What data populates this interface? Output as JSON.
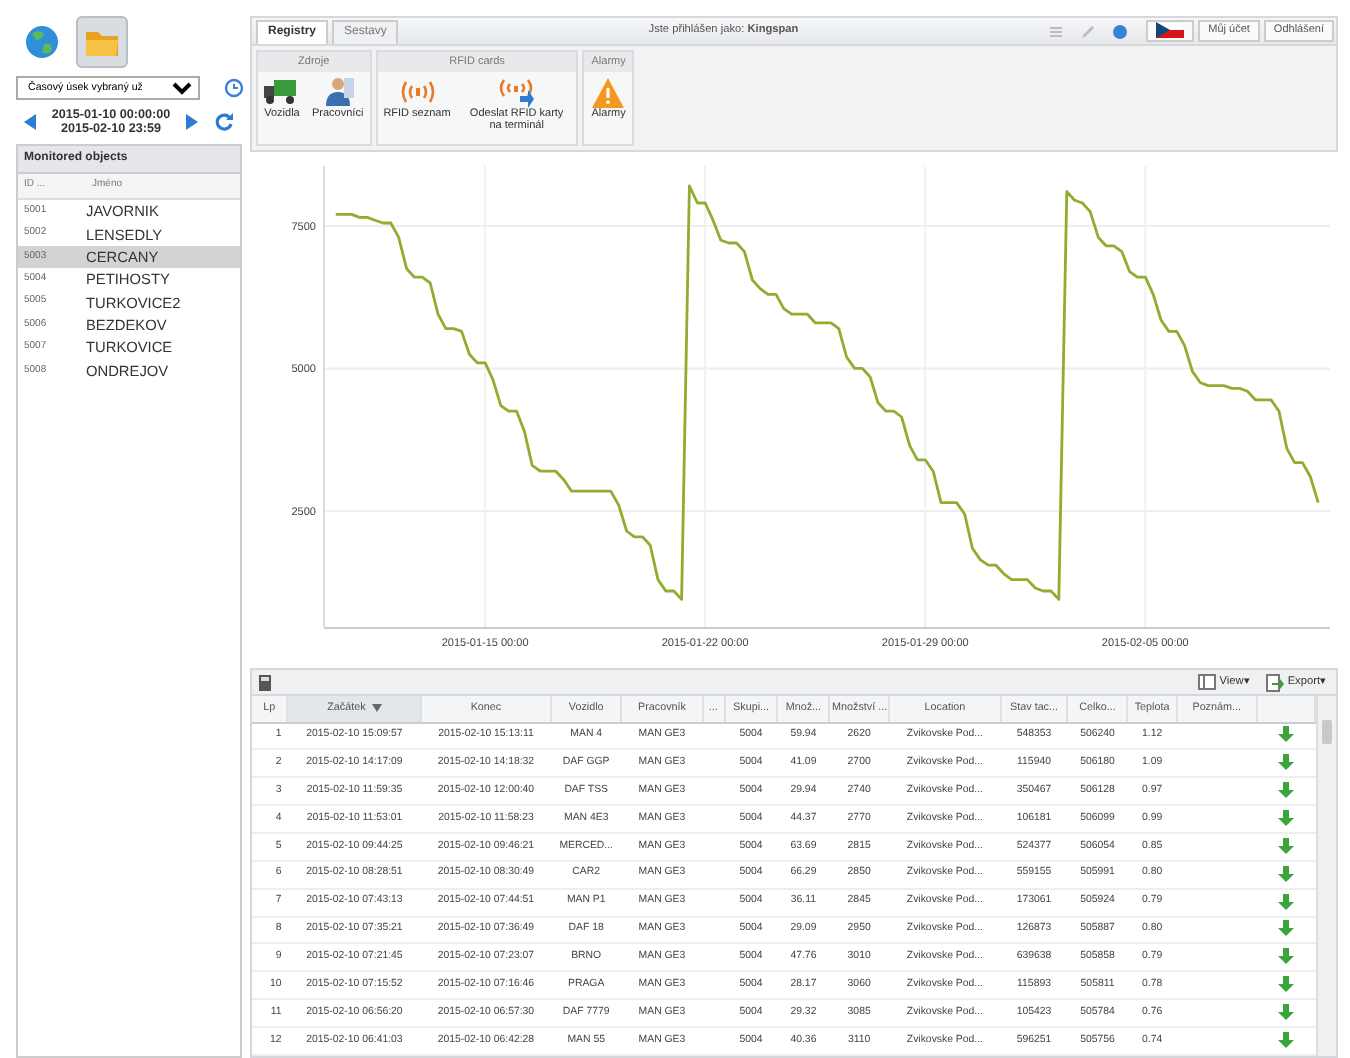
{
  "sidebar": {
    "tool_buttons": [
      {
        "selected": false
      },
      {
        "selected": true
      }
    ],
    "period_select": {
      "value": "Časový úsek vybraný už"
    },
    "date_range": {
      "from": "2015-01-10 00:00:00",
      "to": "2015-02-10 23:59"
    },
    "monitored_objects": {
      "title": "Monitored objects",
      "columns": [
        "ID ...",
        "Jméno"
      ],
      "rows": [
        {
          "id": "5001",
          "name": "JAVORNIK",
          "selected": false
        },
        {
          "id": "5002",
          "name": "LENSEDLY",
          "selected": false
        },
        {
          "id": "5003",
          "name": "CERCANY",
          "selected": true
        },
        {
          "id": "5004",
          "name": "PETIHOSTY",
          "selected": false
        },
        {
          "id": "5005",
          "name": "TURKOVICE2",
          "selected": false
        },
        {
          "id": "5006",
          "name": "BEZDEKOV",
          "selected": false
        },
        {
          "id": "5007",
          "name": "TURKOVICE",
          "selected": false
        },
        {
          "id": "5008",
          "name": "ONDREJOV",
          "selected": false
        }
      ]
    }
  },
  "tabs": [
    {
      "label": "Registry",
      "selected": true
    },
    {
      "label": "Sestavy",
      "selected": false
    }
  ],
  "login_text": "Jste přihlášen jako: **Kingspan**",
  "header_buttons": [
    "Můj účet",
    "Odhlášení"
  ],
  "ribbon": [
    {
      "title": "Zdroje",
      "buttons": [
        "Vozidla",
        "Pracovníci"
      ]
    },
    {
      "title": "RFID cards",
      "buttons": [
        "RFID seznam",
        "Odeslat RFID karty na terminál"
      ]
    },
    {
      "title": "Alarmy",
      "buttons": [
        "Alarmy"
      ]
    }
  ],
  "chart_data": {
    "type": "line",
    "grid": true,
    "ylim": [
      450,
      8550
    ],
    "yticks": [
      2500,
      5000,
      7500
    ],
    "categories": [
      null,
      null,
      null,
      null,
      null,
      null,
      null,
      null,
      null,
      null,
      null,
      null,
      null,
      null,
      null,
      null,
      null,
      null,
      null,
      null,
      "2015-01-15 00:00",
      null,
      null,
      null,
      null,
      null,
      null,
      null,
      null,
      null,
      null,
      null,
      null,
      null,
      null,
      null,
      null,
      null,
      null,
      null,
      null,
      null,
      null,
      null,
      null,
      null,
      null,
      null,
      "2015-01-22 00:00",
      null,
      null,
      null,
      null,
      null,
      null,
      null,
      null,
      null,
      null,
      null,
      null,
      null,
      null,
      null,
      null,
      null,
      null,
      null,
      null,
      null,
      null,
      null,
      null,
      null,
      null,
      null,
      "2015-01-29 00:00",
      null,
      null,
      null,
      null,
      null,
      null,
      null,
      null,
      null,
      null,
      null,
      null,
      null,
      null,
      null,
      null,
      null,
      null,
      null,
      null,
      null,
      null,
      null,
      null,
      null,
      null,
      null,
      "2015-02-05 00:00",
      null,
      null,
      null,
      null,
      null,
      null,
      null,
      null,
      null,
      null,
      null,
      null,
      null,
      null,
      null,
      null,
      null,
      null,
      null,
      null,
      null,
      null,
      null
    ],
    "series": [
      {
        "color": "#8fad2f",
        "values": [
          null,
          7700,
          7700,
          7700,
          7650,
          7650,
          7600,
          7550,
          7550,
          7300,
          6750,
          6600,
          6600,
          6500,
          5950,
          5700,
          5700,
          5650,
          5250,
          5100,
          5100,
          4800,
          4350,
          4250,
          4250,
          3900,
          3300,
          3200,
          3200,
          3200,
          3050,
          2850,
          2850,
          2850,
          2850,
          2850,
          2850,
          2600,
          2150,
          2050,
          2050,
          1900,
          1300,
          1100,
          1100,
          950,
          8200,
          7900,
          7900,
          7600,
          7250,
          7200,
          7200,
          7050,
          6550,
          6400,
          6300,
          6300,
          6050,
          5950,
          5950,
          5950,
          5800,
          5800,
          5800,
          5700,
          5200,
          5000,
          5000,
          4850,
          4400,
          4250,
          4250,
          4150,
          3650,
          3400,
          3400,
          3200,
          2650,
          2650,
          2650,
          2450,
          1850,
          1650,
          1550,
          1550,
          1400,
          1300,
          1300,
          1300,
          1150,
          1100,
          1100,
          950,
          8100,
          7950,
          7900,
          7750,
          7300,
          7150,
          7150,
          7050,
          6700,
          6600,
          6600,
          6300,
          5850,
          5650,
          5650,
          5400,
          4950,
          4750,
          4700,
          4700,
          4700,
          4650,
          4650,
          4600,
          4450,
          4450,
          4450,
          4250,
          3600,
          3350,
          3350,
          3100,
          2650,
          null
        ]
      }
    ]
  },
  "table": {
    "toolbar": [
      "View▾",
      "Export▾"
    ],
    "columns": [
      {
        "label": "Lp",
        "sorted": false
      },
      {
        "label": "Začátek",
        "sorted": true
      },
      {
        "label": "Konec",
        "sorted": false
      },
      {
        "label": "Vozidlo",
        "sorted": false
      },
      {
        "label": "Pracovník",
        "sorted": false
      },
      {
        "label": "...",
        "sorted": false
      },
      {
        "label": "Skupi...",
        "sorted": false
      },
      {
        "label": "Množ...",
        "sorted": false
      },
      {
        "label": "Množství ...",
        "sorted": false
      },
      {
        "label": "Location",
        "sorted": false
      },
      {
        "label": "Stav tac...",
        "sorted": false
      },
      {
        "label": "Celko...",
        "sorted": false
      },
      {
        "label": "Teplota",
        "sorted": false
      },
      {
        "label": "Poznám...",
        "sorted": false
      }
    ],
    "rows": [
      [
        "1",
        "2015-02-10 15:09:57",
        "2015-02-10 15:13:11",
        "MAN 4",
        "MAN GE3",
        "",
        "5004",
        "59.94",
        "2620",
        "Zvikovske Pod...",
        "548353",
        "506240",
        "1.12",
        ""
      ],
      [
        "2",
        "2015-02-10 14:17:09",
        "2015-02-10 14:18:32",
        "DAF GGP",
        "MAN GE3",
        "",
        "5004",
        "41.09",
        "2700",
        "Zvikovske Pod...",
        "115940",
        "506180",
        "1.09",
        ""
      ],
      [
        "3",
        "2015-02-10 11:59:35",
        "2015-02-10 12:00:40",
        "DAF TSS",
        "MAN GE3",
        "",
        "5004",
        "29.94",
        "2740",
        "Zvikovske Pod...",
        "350467",
        "506128",
        "0.97",
        ""
      ],
      [
        "4",
        "2015-02-10 11:53:01",
        "2015-02-10 11:58:23",
        "MAN 4E3",
        "MAN GE3",
        "",
        "5004",
        "44.37",
        "2770",
        "Zvikovske Pod...",
        "106181",
        "506099",
        "0.99",
        ""
      ],
      [
        "5",
        "2015-02-10 09:44:25",
        "2015-02-10 09:46:21",
        "MERCED...",
        "MAN GE3",
        "",
        "5004",
        "63.69",
        "2815",
        "Zvikovske Pod...",
        "524377",
        "506054",
        "0.85",
        ""
      ],
      [
        "6",
        "2015-02-10 08:28:51",
        "2015-02-10 08:30:49",
        "CAR2",
        "MAN GE3",
        "",
        "5004",
        "66.29",
        "2850",
        "Zvikovske Pod...",
        "559155",
        "505991",
        "0.80",
        ""
      ],
      [
        "7",
        "2015-02-10 07:43:13",
        "2015-02-10 07:44:51",
        "MAN P1",
        "MAN GE3",
        "",
        "5004",
        "36.11",
        "2845",
        "Zvikovske Pod...",
        "173061",
        "505924",
        "0.79",
        ""
      ],
      [
        "8",
        "2015-02-10 07:35:21",
        "2015-02-10 07:36:49",
        "DAF 18",
        "MAN GE3",
        "",
        "5004",
        "29.09",
        "2950",
        "Zvikovske Pod...",
        "126873",
        "505887",
        "0.80",
        ""
      ],
      [
        "9",
        "2015-02-10 07:21:45",
        "2015-02-10 07:23:07",
        "BRNO",
        "MAN GE3",
        "",
        "5004",
        "47.76",
        "3010",
        "Zvikovske Pod...",
        "639638",
        "505858",
        "0.79",
        ""
      ],
      [
        "10",
        "2015-02-10 07:15:52",
        "2015-02-10 07:16:46",
        "PRAGA",
        "MAN GE3",
        "",
        "5004",
        "28.17",
        "3060",
        "Zvikovske Pod...",
        "115893",
        "505811",
        "0.78",
        ""
      ],
      [
        "11",
        "2015-02-10 06:56:20",
        "2015-02-10 06:57:30",
        "DAF 7779",
        "MAN GE3",
        "",
        "5004",
        "29.32",
        "3085",
        "Zvikovske Pod...",
        "105423",
        "505784",
        "0.76",
        ""
      ],
      [
        "12",
        "2015-02-10 06:41:03",
        "2015-02-10 06:42:28",
        "MAN 55",
        "MAN GE3",
        "",
        "5004",
        "40.36",
        "3110",
        "Zvikovske Pod...",
        "596251",
        "505756",
        "0.74",
        ""
      ]
    ]
  }
}
